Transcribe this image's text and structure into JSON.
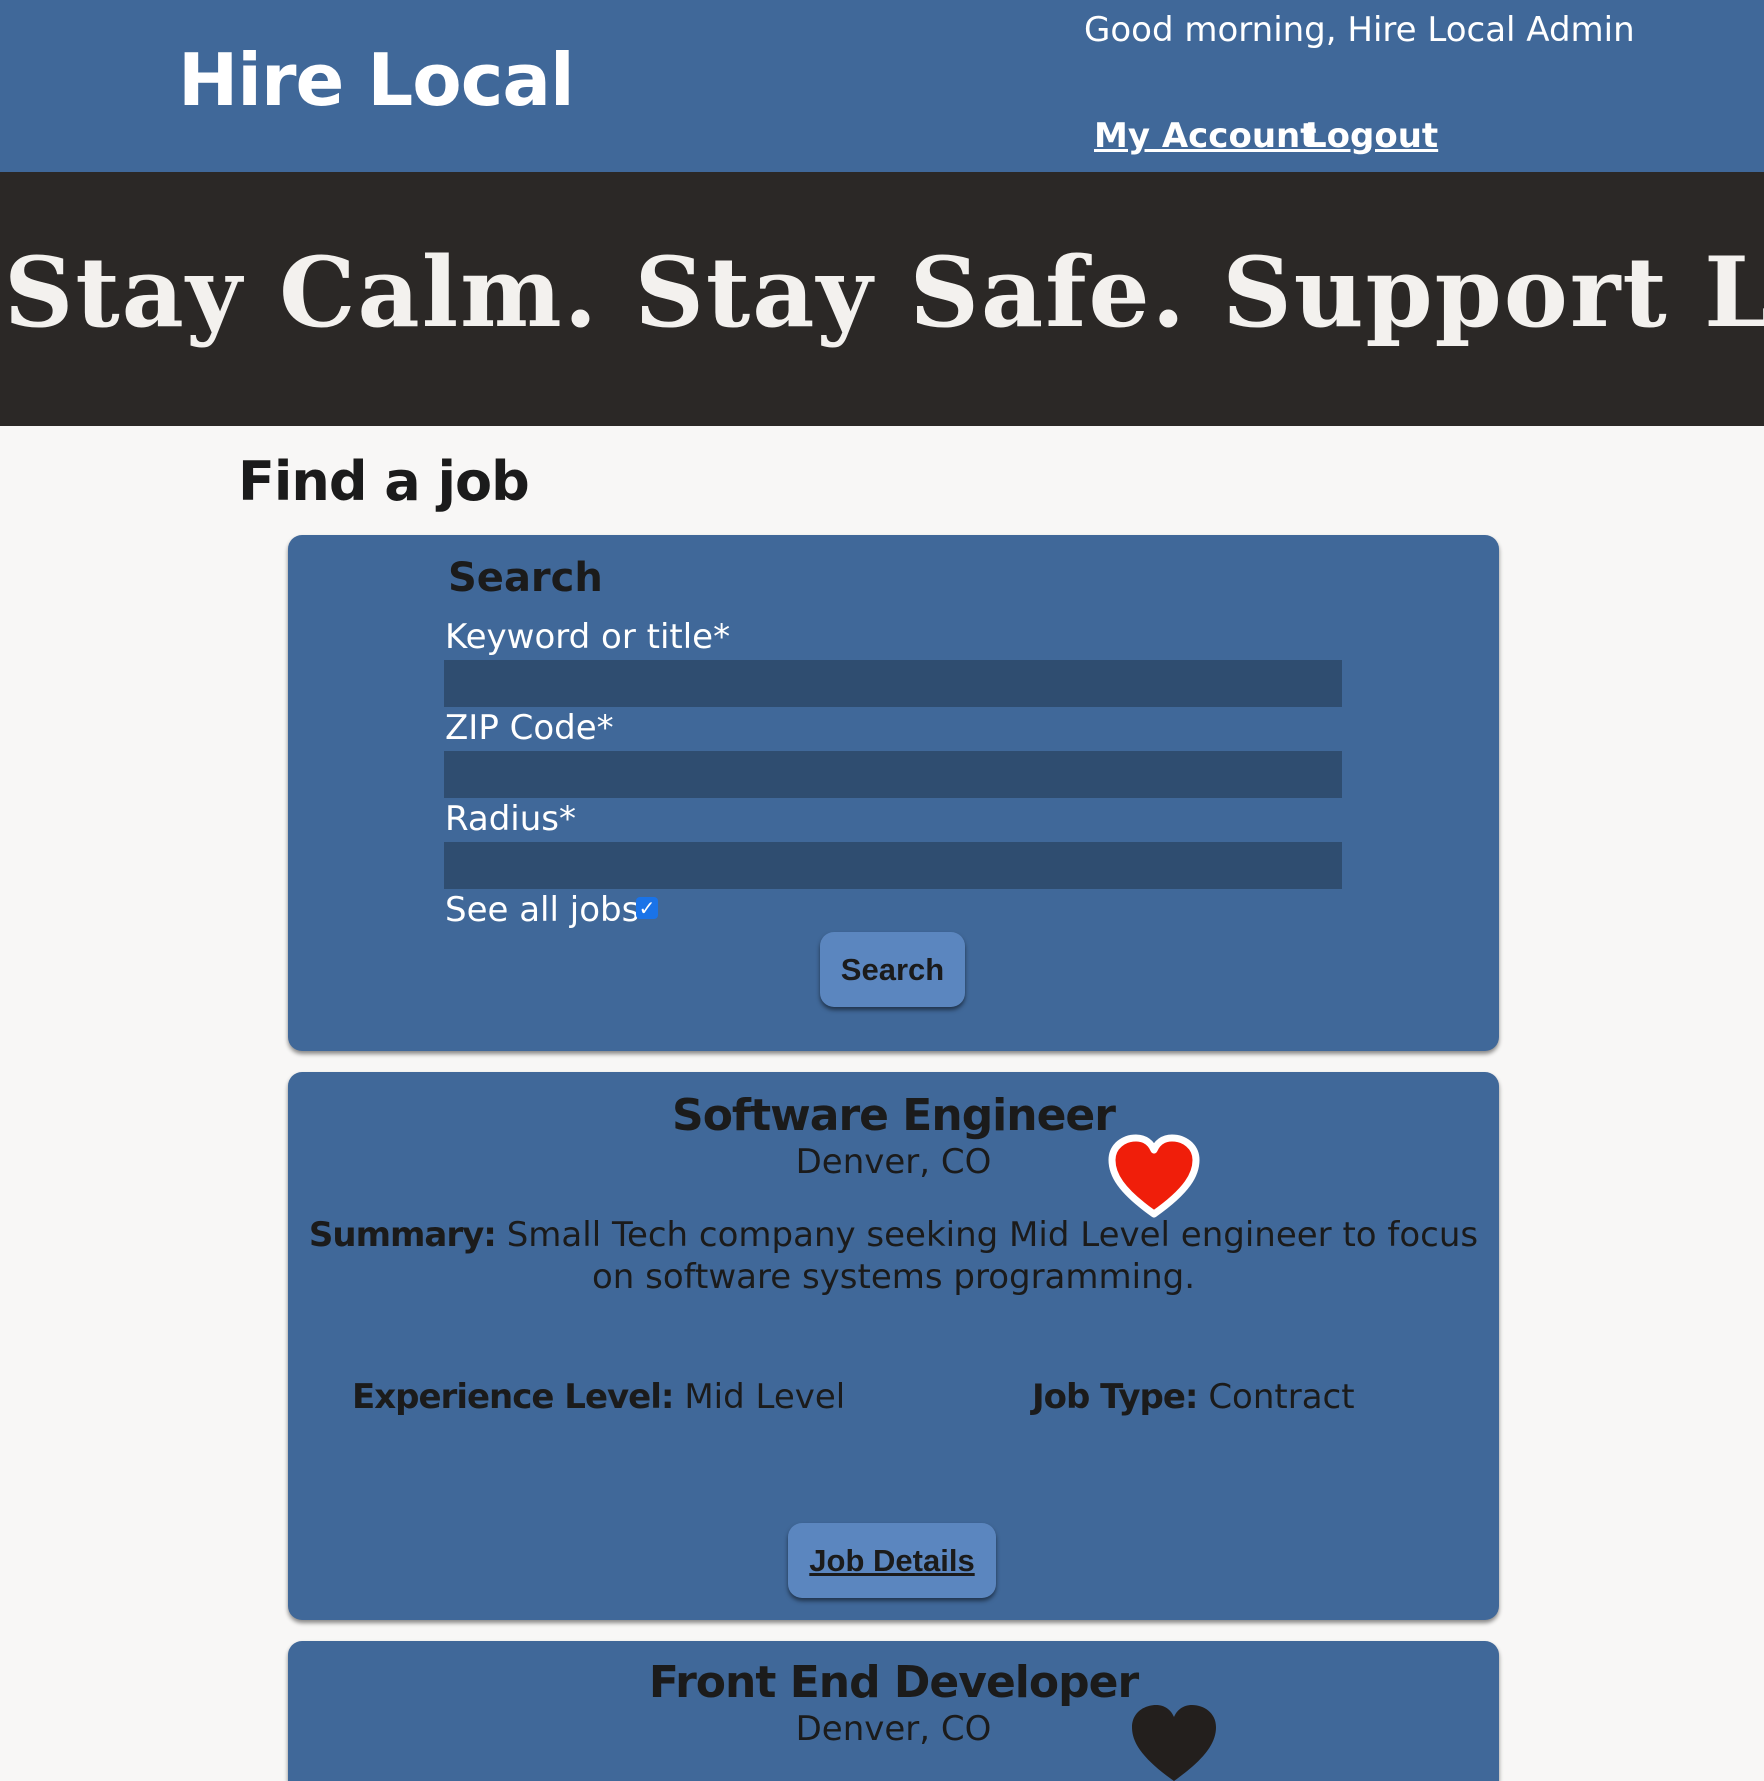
{
  "header": {
    "brand": "Hire Local",
    "greeting": "Good morning, Hire Local Admin",
    "nav": {
      "account": "My Account",
      "logout": "Logout"
    }
  },
  "banner": {
    "text": "Stay Calm. Stay Safe. Support Local."
  },
  "page_title": "Find a job",
  "search": {
    "heading": "Search",
    "keyword_label": "Keyword or title*",
    "keyword_value": "",
    "zip_label": "ZIP Code*",
    "zip_value": "",
    "radius_label": "Radius*",
    "radius_value": "",
    "see_all_label": "See all jobs",
    "see_all_checked": true,
    "button_label": "Search"
  },
  "jobs": [
    {
      "title": "Software Engineer",
      "location": "Denver, CO",
      "favorited": true,
      "summary_label": "Summary:",
      "summary": "Small Tech company seeking Mid Level engineer to focus on software systems programming.",
      "experience_label": "Experience Level:",
      "experience": "Mid Level",
      "job_type_label": "Job Type:",
      "job_type": "Contract",
      "details_label": "Job Details"
    },
    {
      "title": "Front End Developer",
      "location": "Denver, CO",
      "favorited": false
    }
  ],
  "colors": {
    "primary": "#406899",
    "banner_bg": "#2b2826",
    "input_bg": "#2f4d70",
    "button_bg": "#5b86bf",
    "heart_active": "#f01e0a",
    "heart_inactive": "#231f1d",
    "page_bg": "#f8f7f6"
  },
  "icons": {
    "favorite_active": "heart-icon",
    "favorite_inactive": "heart-icon",
    "checkbox": "checkmark-icon"
  }
}
